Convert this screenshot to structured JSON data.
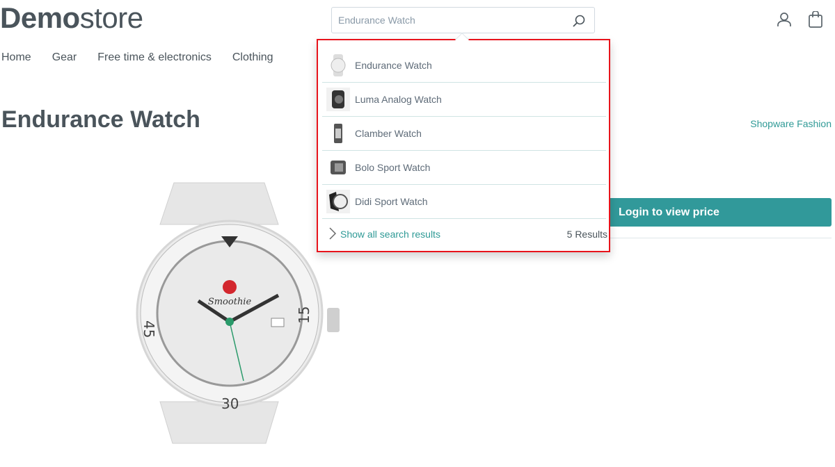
{
  "header": {
    "logo_bold": "Demo",
    "logo_light": "store",
    "search_value": "Endurance Watch"
  },
  "nav": [
    "Home",
    "Gear",
    "Free time & electronics",
    "Clothing"
  ],
  "product": {
    "title": "Endurance Watch",
    "manufacturer": "Shopware Fashion",
    "login_button": "Login to view price",
    "watch_brand": "Smoothie"
  },
  "suggest": {
    "items": [
      "Endurance Watch",
      "Luma Analog Watch",
      "Clamber Watch",
      "Bolo Sport Watch",
      "Didi Sport Watch"
    ],
    "show_all": "Show all search results",
    "count": "5 Results"
  },
  "colors": {
    "accent": "#31999a",
    "highlight_border": "#e8131b"
  }
}
